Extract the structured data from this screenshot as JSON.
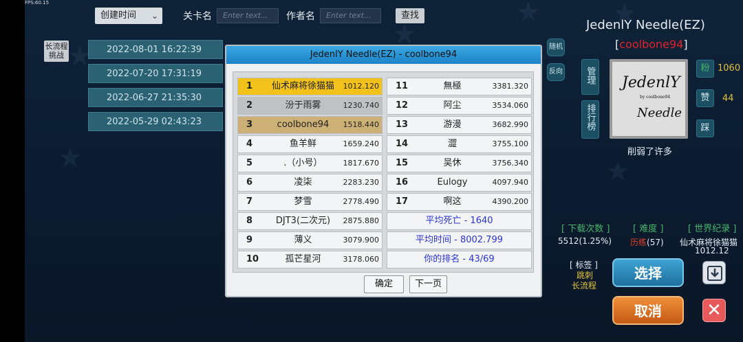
{
  "fps": "FPS:60.15",
  "sort": {
    "selected": "创建时间"
  },
  "search": {
    "level_label": "关卡名",
    "level_placeholder": "Enter text...",
    "author_label": "作者名",
    "author_placeholder": "Enter text...",
    "find_label": "查找"
  },
  "long_challenge": "长流程\n挑战",
  "list_rows": [
    "2022-08-01 16:22:39",
    "2022-07-20 17:31:19",
    "2022-06-27 21:35:30",
    "2022-05-29 02:43:23"
  ],
  "side_buttons": {
    "random": "随机",
    "reverse": "反向"
  },
  "level": {
    "title": "JedenlY Needle(EZ)",
    "author": "coolbone94",
    "description": "削弱了许多",
    "thumb_line1": "JedenlY",
    "thumb_line2": "by coolbone94",
    "thumb_line3": "Needle"
  },
  "panel_buttons": {
    "manage": "管理",
    "leaderboard": "排行榜",
    "fans": "粉",
    "like": "赞",
    "dislike": "踩"
  },
  "counts": {
    "fans": "1060",
    "likes": "44"
  },
  "stats": {
    "downloads_label": "[ 下载次数 ]",
    "downloads_value": "5512(1.25%)",
    "difficulty_label": "[ 难度 ]",
    "difficulty_name": "历练",
    "difficulty_value": "(57)",
    "record_label": "[ 世界纪录 ]",
    "record_holder": "仙术麻将徐猫猫",
    "record_time": "1012.12"
  },
  "tags": {
    "label": "[ 标签 ]",
    "items": [
      "跳刺",
      "长流程"
    ]
  },
  "actions": {
    "choose": "选择",
    "cancel": "取消"
  },
  "modal": {
    "title": "JedenlY Needle(EZ)   - coolbone94",
    "left": [
      {
        "rank": "1",
        "name": "仙术麻将徐猫猫",
        "time": "1012.120"
      },
      {
        "rank": "2",
        "name": "汾于雨雾",
        "time": "1230.740"
      },
      {
        "rank": "3",
        "name": "coolbone94",
        "time": "1518.440"
      },
      {
        "rank": "4",
        "name": "鱼羊鲜",
        "time": "1659.240"
      },
      {
        "rank": "5",
        "name": ".（小号）",
        "time": "1817.670"
      },
      {
        "rank": "6",
        "name": "凌柒",
        "time": "2283.230"
      },
      {
        "rank": "7",
        "name": "梦雪",
        "time": "2778.490"
      },
      {
        "rank": "8",
        "name": "DJT3(二次元)",
        "time": "2875.880"
      },
      {
        "rank": "9",
        "name": "薄义",
        "time": "3079.900"
      },
      {
        "rank": "10",
        "name": "孤芒星河",
        "time": "3178.060"
      }
    ],
    "right": [
      {
        "rank": "11",
        "name": "無極",
        "time": "3381.320"
      },
      {
        "rank": "12",
        "name": "阿尘",
        "time": "3534.060"
      },
      {
        "rank": "13",
        "name": "游漫",
        "time": "3682.990"
      },
      {
        "rank": "14",
        "name": "澀",
        "time": "3755.100"
      },
      {
        "rank": "15",
        "name": "吴休",
        "time": "3756.340"
      },
      {
        "rank": "16",
        "name": "Eulogy",
        "time": "4097.940"
      },
      {
        "rank": "17",
        "name": "啊这",
        "time": "4390.200"
      }
    ],
    "avg_death": "平均死亡 - 1640",
    "avg_time": "平均时间 - 8002.799",
    "your_rank": "你的排名 - 43/69",
    "ok": "确定",
    "next": "下一页"
  }
}
